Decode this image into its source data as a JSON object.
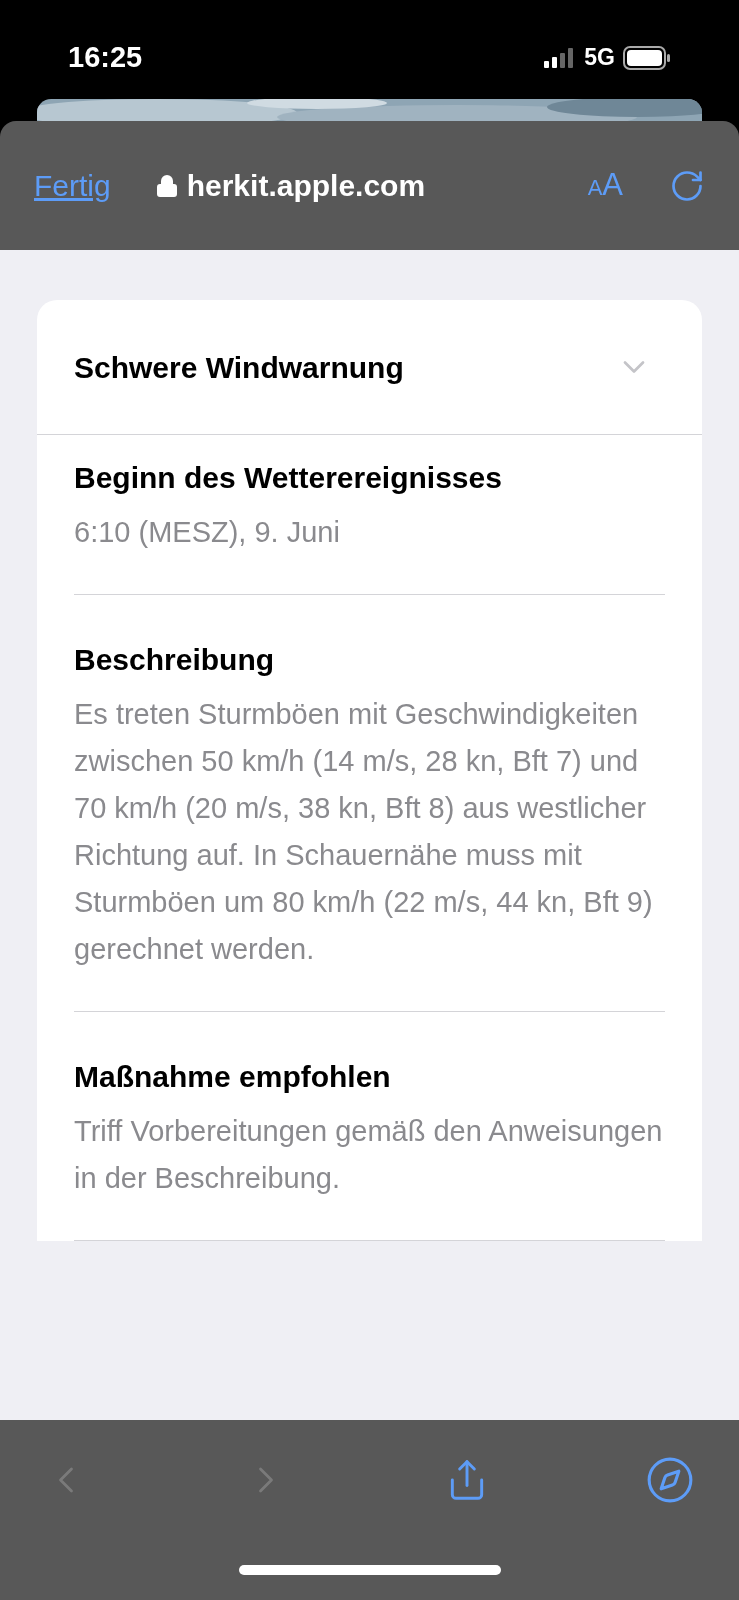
{
  "status_bar": {
    "time": "16:25",
    "network": "5G"
  },
  "browser_header": {
    "done": "Fertig",
    "url": "herkit.apple.com",
    "text_size": "AA"
  },
  "card": {
    "title": "Schwere Windwarnung",
    "expanded": true,
    "sections": [
      {
        "heading": "Beginn des Wetterereignisses",
        "text": "6:10 (MESZ), 9. Juni"
      },
      {
        "heading": "Beschreibung",
        "text": "Es treten Sturmböen mit Geschwindigkeiten zwischen 50 km/h (14 m/s, 28 kn, Bft 7) und 70 km/h (20 m/s, 38 kn, Bft 8) aus westlicher Richtung auf. In Schauernähe muss mit Sturmböen um 80 km/h (22 m/s, 44 kn, Bft 9) gerechnet werden."
      },
      {
        "heading": "Maßnahme empfohlen",
        "text": "Triff Vorbereitungen gemäß den Anweisungen in der Beschreibung."
      }
    ]
  },
  "toolbar": {
    "back_disabled": true,
    "forward_disabled": true
  }
}
